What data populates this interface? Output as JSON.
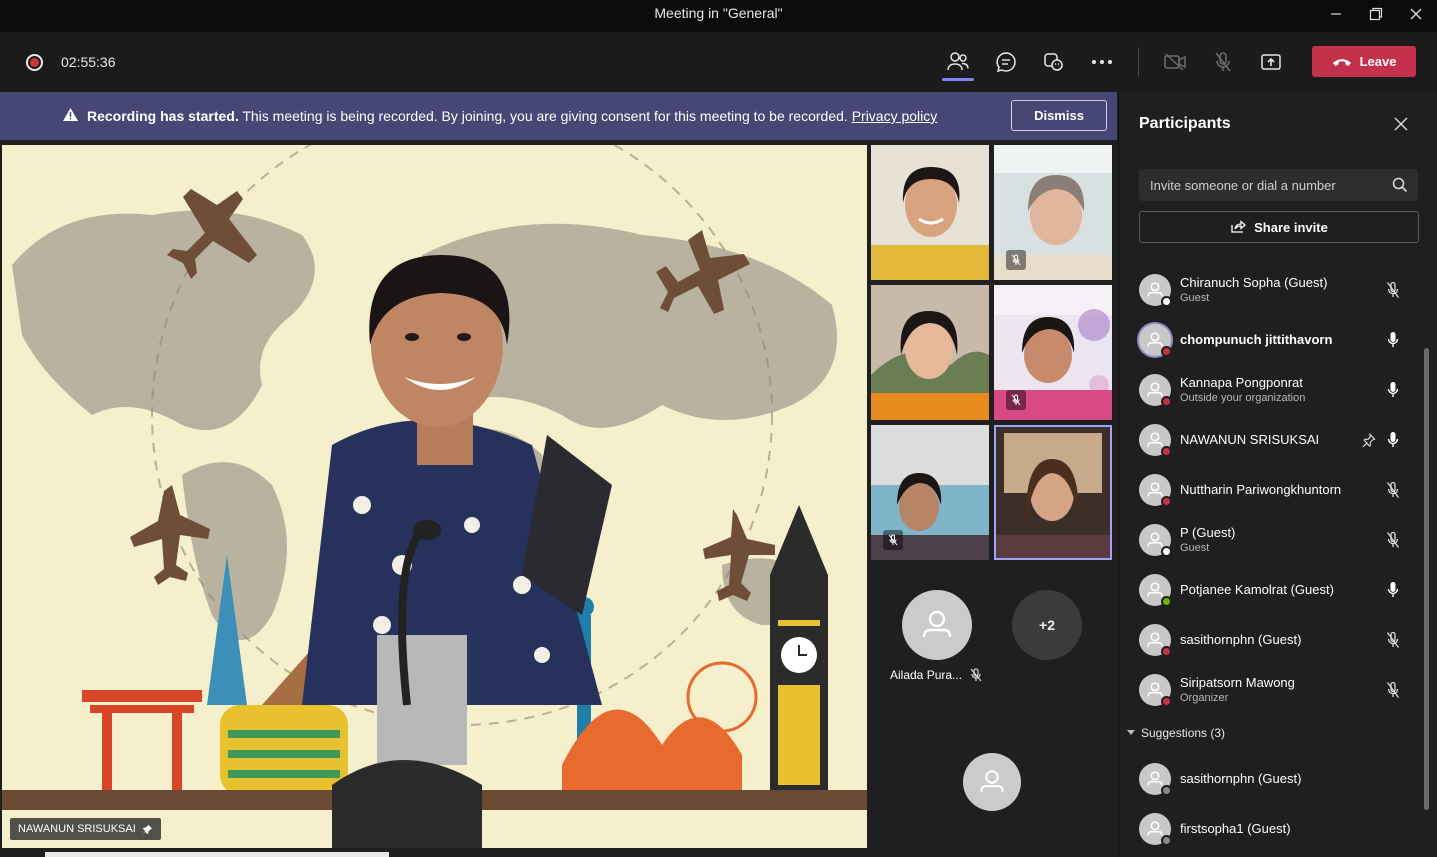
{
  "window": {
    "title": "Meeting in \"General\""
  },
  "toolbar": {
    "timer": "02:55:36",
    "leave_label": "Leave",
    "colors": {
      "leave": "#c4314b",
      "accent": "#7f85f5"
    }
  },
  "banner": {
    "bold_text": "Recording has started.",
    "text": " This meeting is being recorded. By joining, you are giving consent for this meeting to be recorded. ",
    "link": "Privacy policy",
    "dismiss_label": "Dismiss"
  },
  "stage": {
    "speaker_name": "NAWANUN SRISUKSAI"
  },
  "gallery": {
    "avatar_name": "Ailada Pura...",
    "more_count": "+2"
  },
  "panel": {
    "title": "Participants",
    "invite_placeholder": "Invite someone or dial a number",
    "share_label": "Share invite",
    "participants": [
      {
        "name": "Chiranuch Sopha (Guest)",
        "sub": "Guest",
        "status": "offline",
        "mic": "muted"
      },
      {
        "name": "chompunuch jittithavorn",
        "sub": "",
        "status": "busy",
        "mic": "on",
        "bold": true
      },
      {
        "name": "Kannapa Pongponrat",
        "sub": "Outside your organization",
        "status": "busy",
        "mic": "on"
      },
      {
        "name": "NAWANUN SRISUKSAI",
        "sub": "",
        "status": "busy",
        "mic": "on",
        "pinned": true
      },
      {
        "name": "Nuttharin Pariwongkhuntorn",
        "sub": "",
        "status": "busy",
        "mic": "muted"
      },
      {
        "name": "P (Guest)",
        "sub": "Guest",
        "status": "offline",
        "mic": "muted"
      },
      {
        "name": "Potjanee Kamolrat (Guest)",
        "sub": "",
        "status": "available",
        "mic": "on"
      },
      {
        "name": "sasithornphn (Guest)",
        "sub": "",
        "status": "busy",
        "mic": "muted"
      },
      {
        "name": "Siripatsorn Mawong",
        "sub": "Organizer",
        "status": "busy",
        "mic": "muted"
      }
    ],
    "suggestions_label": "Suggestions (3)",
    "suggestions": [
      {
        "name": "sasithornphn (Guest)"
      },
      {
        "name": "firstsopha1 (Guest)"
      }
    ]
  }
}
